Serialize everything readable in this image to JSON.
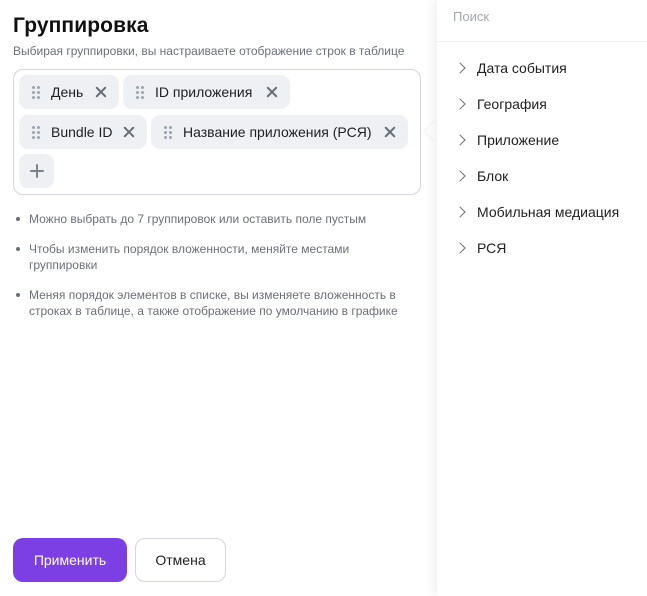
{
  "dialog": {
    "title": "Группировка",
    "subtitle": "Выбирая группировки, вы настраиваете отображение строк в таблице",
    "chips": [
      {
        "label": "День"
      },
      {
        "label": "ID приложения"
      },
      {
        "label": "Bundle ID"
      },
      {
        "label": "Название приложения (РСЯ)"
      }
    ],
    "hints": [
      "Можно выбрать до 7 группировок или оставить поле пустым",
      "Чтобы изменить порядок вложенности, меняйте местами группировки",
      "Меняя порядок элементов в списке, вы изменяете вложенность в строках в таблице, а также отображение по умолчанию в графике"
    ],
    "apply_label": "Применить",
    "cancel_label": "Отмена"
  },
  "picker": {
    "search_placeholder": "Поиск",
    "search_value": "",
    "categories": [
      {
        "label": "Дата события"
      },
      {
        "label": "География"
      },
      {
        "label": "Приложение"
      },
      {
        "label": "Блок"
      },
      {
        "label": "Мобильная медиация"
      },
      {
        "label": "РСЯ"
      }
    ]
  },
  "colors": {
    "accent": "#7b3fe4",
    "chip_bg": "#eef0f4",
    "muted_text": "#6b6f78"
  }
}
